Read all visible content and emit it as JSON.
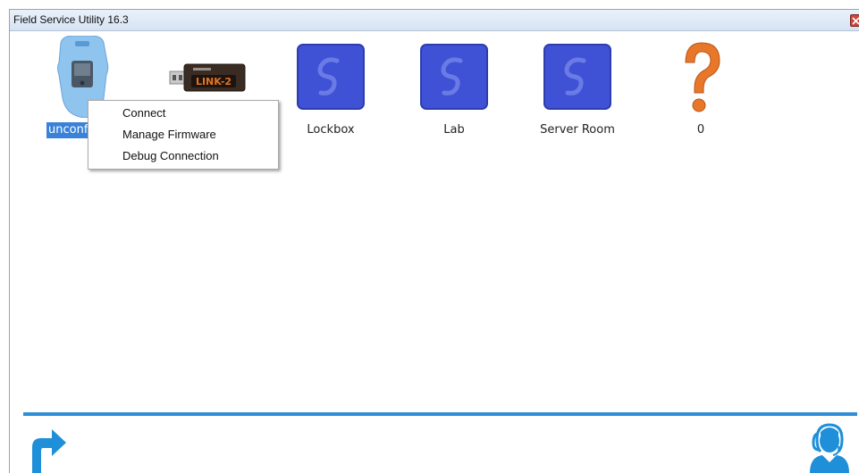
{
  "window": {
    "title": "Field Service Utility 16.3"
  },
  "devices": [
    {
      "label": "unconfigured",
      "icon": "handheld-device-icon",
      "selected": true
    },
    {
      "label": "",
      "icon": "link-2-usb-icon",
      "badge": "LINK-2"
    },
    {
      "label": "Lockbox",
      "icon": "lockbox-device-icon"
    },
    {
      "label": "Lab",
      "icon": "lab-device-icon"
    },
    {
      "label": "Server Room",
      "icon": "server-room-device-icon"
    },
    {
      "label": "0",
      "icon": "question-mark-icon"
    }
  ],
  "context_menu": {
    "items": [
      {
        "label": "Connect"
      },
      {
        "label": "Manage Firmware"
      },
      {
        "label": "Debug Connection"
      }
    ]
  },
  "footer": {
    "back_icon": "back-arrow-icon",
    "support_icon": "support-agent-icon"
  },
  "colors": {
    "accent": "#2e8fd8",
    "device_tile": "#3f52d6",
    "selection": "#3a82d8",
    "question": "#e8772a"
  }
}
